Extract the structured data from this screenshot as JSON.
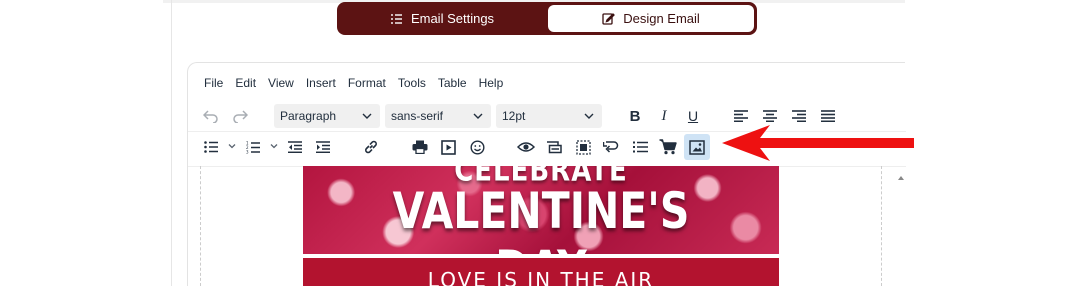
{
  "tabs": {
    "email_settings": "Email Settings",
    "design_email": "Design Email"
  },
  "menubar": [
    "File",
    "Edit",
    "View",
    "Insert",
    "Format",
    "Tools",
    "Table",
    "Help"
  ],
  "toolbar": {
    "block_format": "Paragraph",
    "font_family": "sans-serif",
    "font_size": "12pt",
    "bold": "B",
    "italic": "I",
    "underline": "U"
  },
  "banner": {
    "top_word": "CELEBRATE",
    "title": "VALENTINE'S DAY",
    "subtitle": "LOVE IS IN THE AIR"
  },
  "colors": {
    "tab_bg": "#5c1313",
    "active_button": "#cfe3f5",
    "arrow": "#ee1111",
    "banner_band": "#b3132f"
  }
}
